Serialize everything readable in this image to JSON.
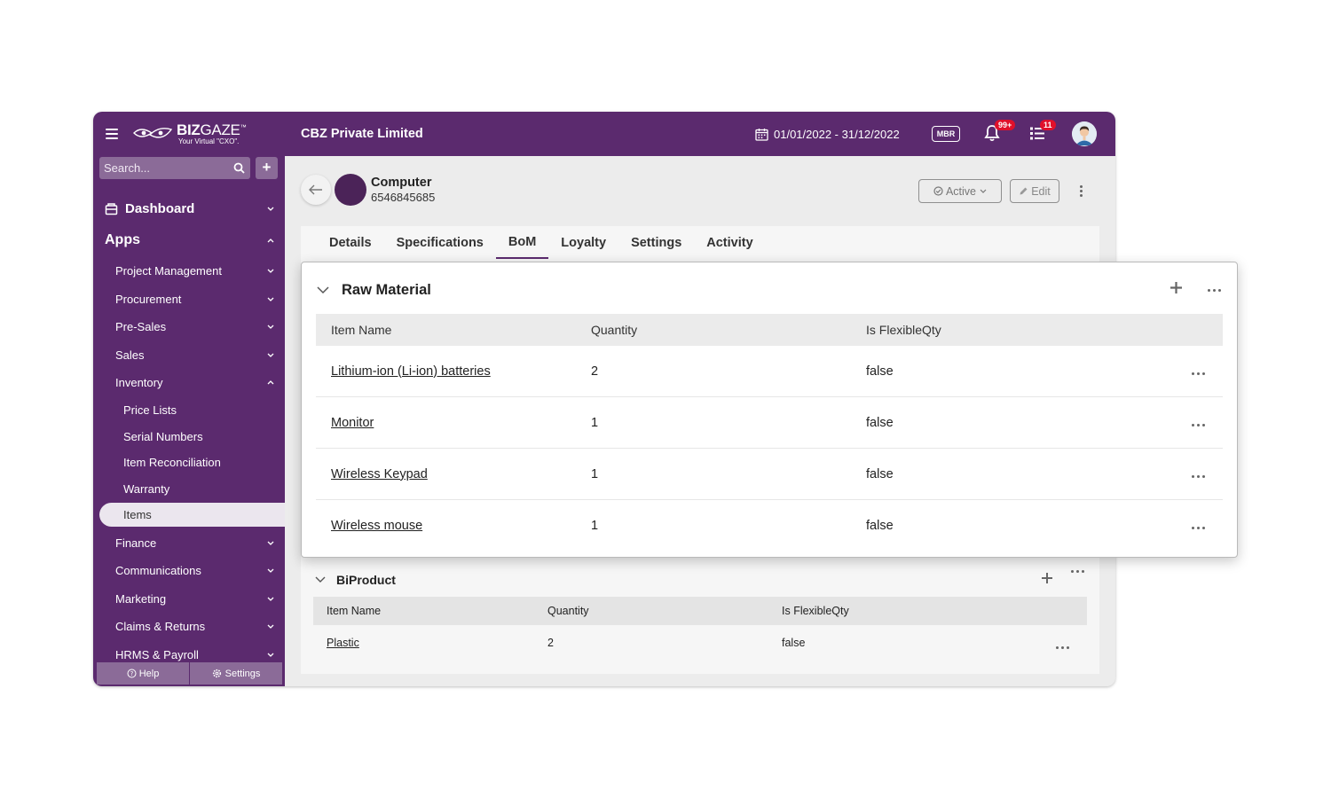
{
  "brand": {
    "name_bold": "BIZ",
    "name_rest": "GAZE",
    "tm": "™",
    "tagline": "Your Virtual \"CXO\"."
  },
  "search": {
    "placeholder": "Search..."
  },
  "sidebar": {
    "dashboard": "Dashboard",
    "apps": "Apps",
    "items": [
      {
        "label": "Project Management"
      },
      {
        "label": "Procurement"
      },
      {
        "label": "Pre-Sales"
      },
      {
        "label": "Sales"
      },
      {
        "label": "Inventory"
      }
    ],
    "inventory_sub": [
      {
        "label": "Price Lists"
      },
      {
        "label": "Serial Numbers"
      },
      {
        "label": "Item Reconciliation"
      },
      {
        "label": "Warranty"
      },
      {
        "label": "Items"
      }
    ],
    "items_after": [
      {
        "label": "Finance"
      },
      {
        "label": "Communications"
      },
      {
        "label": "Marketing"
      },
      {
        "label": "Claims & Returns"
      },
      {
        "label": "HRMS & Payroll"
      }
    ],
    "help": "Help",
    "settings": "Settings"
  },
  "header": {
    "company": "CBZ Private Limited",
    "date_range": "01/01/2022 - 31/12/2022",
    "mbr": "MBR",
    "notif_badge": "99+",
    "tasks_badge": "11"
  },
  "record": {
    "title": "Computer",
    "code": "6546845685",
    "status": "Active",
    "edit": "Edit"
  },
  "tabs": [
    {
      "label": "Details"
    },
    {
      "label": "Specifications"
    },
    {
      "label": "BoM"
    },
    {
      "label": "Loyalty"
    },
    {
      "label": "Settings"
    },
    {
      "label": "Activity"
    }
  ],
  "raw_material": {
    "title": "Raw Material",
    "columns": [
      "Item Name",
      "Quantity",
      "Is FlexibleQty"
    ],
    "rows": [
      {
        "name": "Lithium-ion (Li-ion) batteries",
        "qty": "2",
        "flex": "false"
      },
      {
        "name": "Monitor",
        "qty": "1",
        "flex": "false"
      },
      {
        "name": "Wireless Keypad",
        "qty": "1",
        "flex": "false"
      },
      {
        "name": "Wireless mouse",
        "qty": "1",
        "flex": "false"
      }
    ]
  },
  "biproduct": {
    "title": "BiProduct",
    "columns": [
      "Item Name",
      "Quantity",
      "Is FlexibleQty"
    ],
    "rows": [
      {
        "name": "Plastic",
        "qty": "2",
        "flex": "false"
      }
    ]
  },
  "colors": {
    "brand": "#5b2a6e",
    "accent_light": "#8b6b98",
    "badge": "#e0102a"
  }
}
